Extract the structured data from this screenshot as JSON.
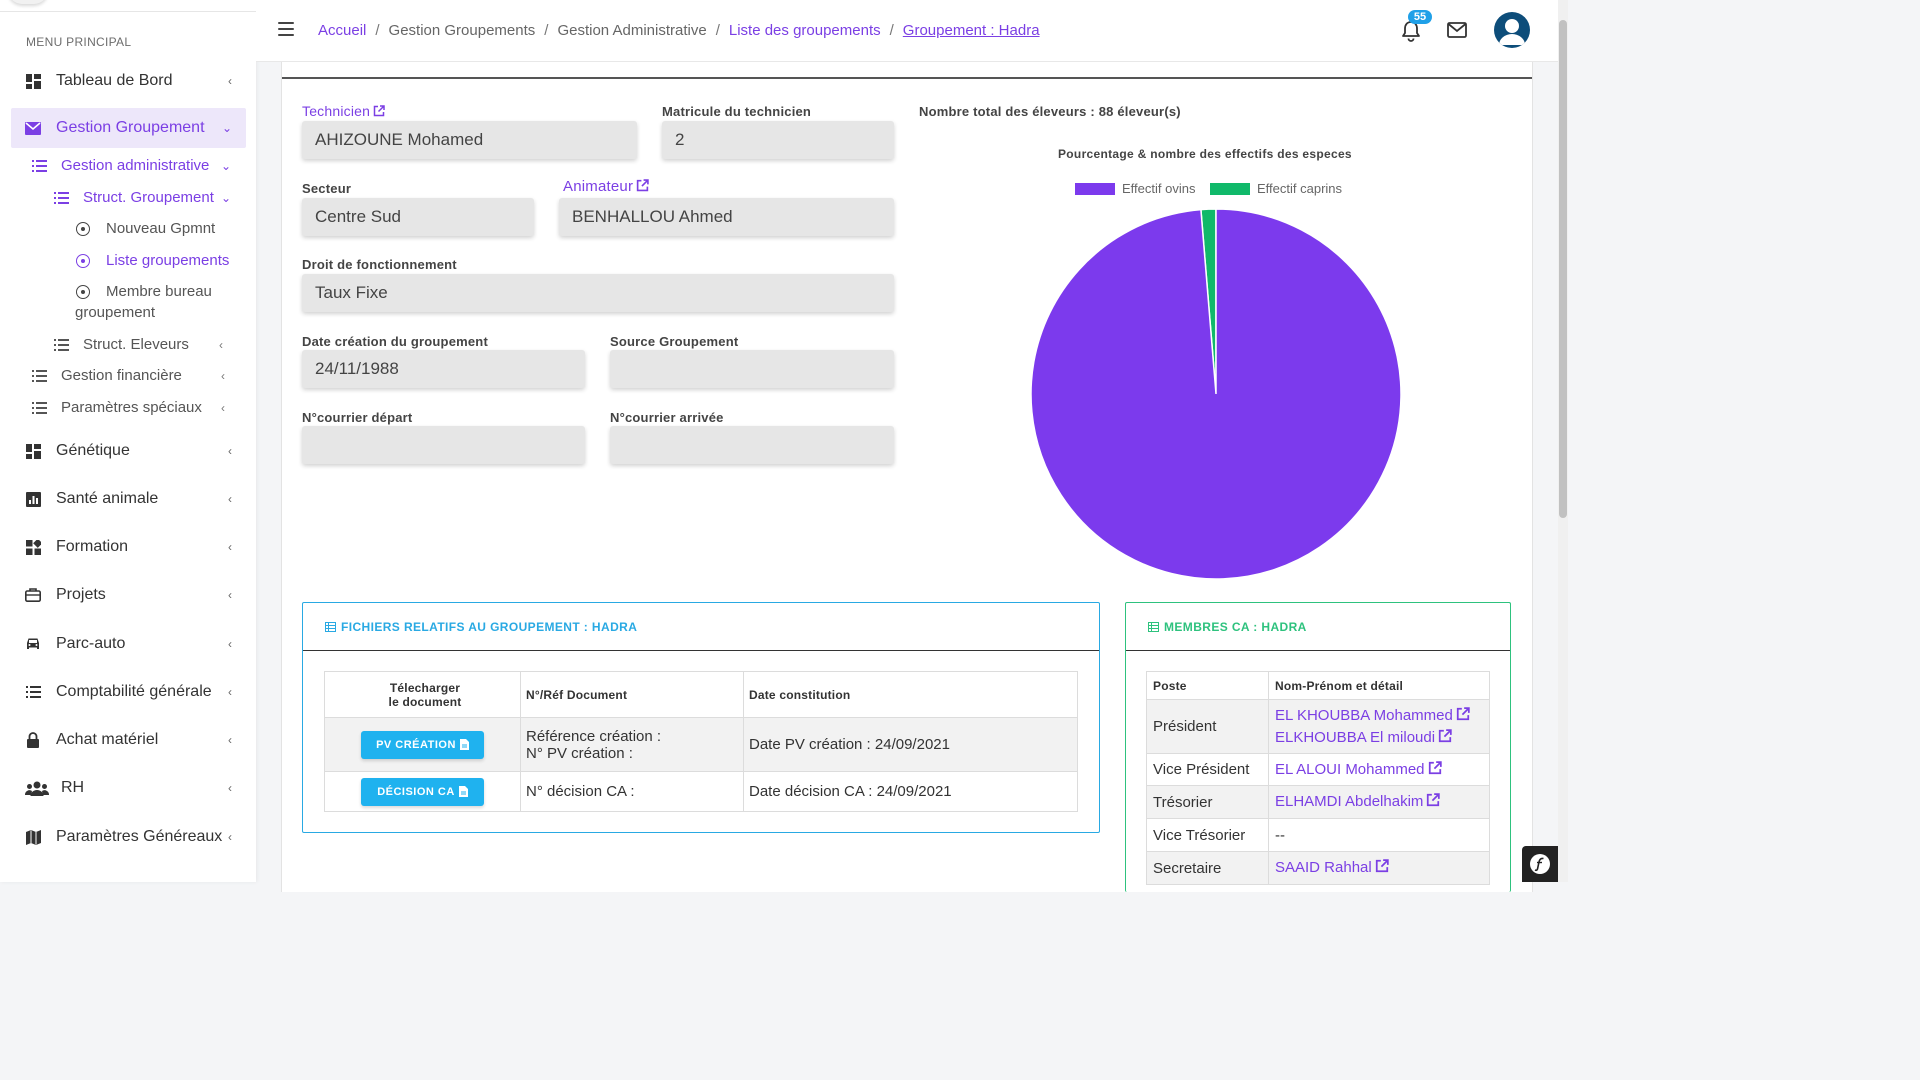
{
  "sidebar": {
    "menu_title": "MENU PRINCIPAL",
    "items": [
      {
        "label": "Tableau de Bord",
        "icon": "dashboard-icon"
      },
      {
        "label": "Gestion Groupement",
        "icon": "envelope-icon",
        "active": true
      },
      {
        "label": "Génétique",
        "icon": "dashboard-icon"
      },
      {
        "label": "Santé animale",
        "icon": "bar-chart-icon"
      },
      {
        "label": "Formation",
        "icon": "grid-icon"
      },
      {
        "label": "Projets",
        "icon": "briefcase-icon"
      },
      {
        "label": "Parc-auto",
        "icon": "car-icon"
      },
      {
        "label": "Comptabilité générale",
        "icon": "list-icon"
      },
      {
        "label": "Achat matériel",
        "icon": "lock-icon"
      },
      {
        "label": "RH",
        "icon": "users-icon"
      },
      {
        "label": "Paramètres Généreaux",
        "icon": "map-icon"
      }
    ],
    "sub": {
      "gestion_administrative": "Gestion administrative",
      "struct_groupement": "Struct. Groupement",
      "nouveau_gpmnt": "Nouveau Gpmnt",
      "liste_groupements": "Liste groupements",
      "membre_bureau_1": "Membre bureau",
      "membre_bureau_2": "groupement",
      "struct_eleveurs": "Struct. Eleveurs",
      "gestion_financiere": "Gestion financière",
      "parametres_speciaux": "Paramètres spéciaux"
    }
  },
  "header": {
    "breadcrumb": [
      "Accueil",
      "Gestion Groupements",
      "Gestion Administrative",
      "Liste des groupements",
      "Groupement : Hadra"
    ],
    "notifications_count": "55"
  },
  "form": {
    "technicien_label": "Technicien",
    "technicien_value": "AHIZOUNE Mohamed",
    "matricule_label": "Matricule du technicien",
    "matricule_value": "2",
    "secteur_label": "Secteur",
    "secteur_value": "Centre Sud",
    "animateur_label": "Animateur",
    "animateur_value": "BENHALLOU Ahmed",
    "droit_label": "Droit de fonctionnement",
    "droit_value": "Taux Fixe",
    "date_creation_label": "Date création du groupement",
    "date_creation_value": "24/11/1988",
    "source_label": "Source Groupement",
    "source_value": "",
    "courrier_depart_label": "N°courrier départ",
    "courrier_depart_value": "",
    "courrier_arrivee_label": "N°courrier arrivée",
    "courrier_arrivee_value": ""
  },
  "summary": {
    "total_eleveurs": "Nombre total des éleveurs : 88 éleveur(s)"
  },
  "chart_data": {
    "type": "pie",
    "title": "Pourcentage & nombre des effectifs des especes",
    "series": [
      {
        "name": "Effectif ovins",
        "value": 98.7,
        "color": "#7c3aed"
      },
      {
        "name": "Effectif caprins",
        "value": 1.3,
        "color": "#10b96a"
      }
    ],
    "legend": "top"
  },
  "files_panel": {
    "title": "FICHIERS RELATIFS AU GROUPEMENT : HADRA",
    "headers": [
      "Télecharger",
      "le document",
      "N°/Réf Document",
      "Date constitution"
    ],
    "rows": [
      {
        "button": "PV CRÉATION",
        "ref_line1": "Référence création :",
        "ref_line2": "N° PV création :",
        "date": "Date PV création : 24/09/2021"
      },
      {
        "button": "DÉCISION CA",
        "ref_line1": "N° décision CA :",
        "ref_line2": "",
        "date": "Date décision CA : 24/09/2021"
      }
    ]
  },
  "members_panel": {
    "title": "MEMBRES CA : HADRA",
    "headers": [
      "Poste",
      "Nom-Prénom et détail"
    ],
    "rows": [
      {
        "poste": "Président",
        "names": [
          "EL KHOUBBA Mohammed",
          "ELKHOUBBA El miloudi"
        ]
      },
      {
        "poste": "Vice Président",
        "names": [
          "EL ALOUI Mohammed"
        ]
      },
      {
        "poste": "Trésorier",
        "names": [
          "ELHAMDI Abdelhakim"
        ]
      },
      {
        "poste": "Vice Trésorier",
        "names": [
          "--"
        ]
      },
      {
        "poste": "Secretaire",
        "names": [
          "SAAID Rahhal"
        ]
      }
    ]
  },
  "colors": {
    "accent": "#7b3fe4",
    "info": "#29a9e3",
    "success": "#2ec27e"
  }
}
